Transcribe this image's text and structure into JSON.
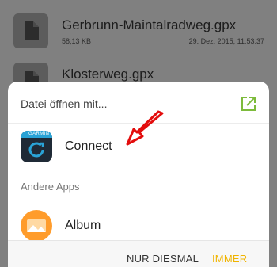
{
  "files": [
    {
      "name": "Gerbrunn-Maintalradweg.gpx",
      "size": "58,13 KB",
      "date": "29. Dez. 2015, 11:53:37"
    },
    {
      "name": "Klosterweg.gpx"
    }
  ],
  "chooser": {
    "title": "Datei öffnen mit...",
    "apps": [
      {
        "label": "Connect",
        "brand": "GARMIN",
        "icon": "garmin-connect-icon"
      },
      {
        "label": "Album",
        "icon": "album-icon"
      }
    ],
    "section_other": "Andere Apps",
    "buttons": {
      "once": "NUR DIESMAL",
      "always": "IMMER"
    }
  },
  "colors": {
    "accent": "#f0b400",
    "annotation_arrow": "#e30d0d",
    "external_icon": "#7dbb3c"
  }
}
